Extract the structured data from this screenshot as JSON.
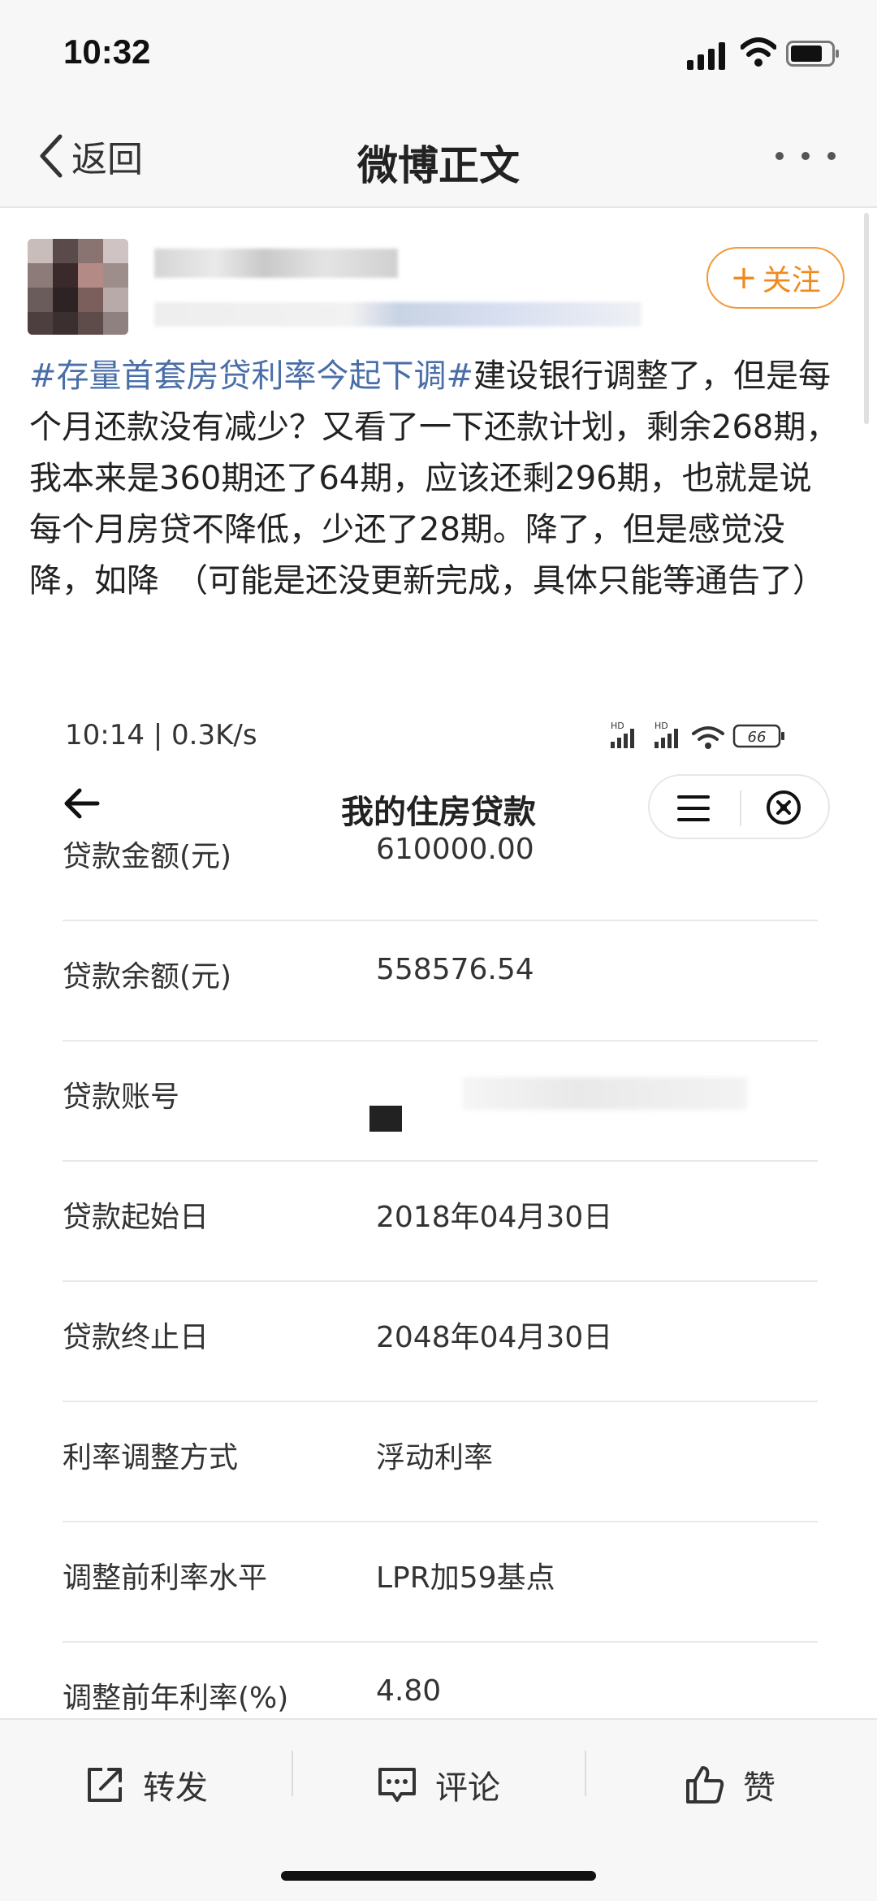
{
  "status_bar": {
    "time": "10:32",
    "signal_icon": "signal-icon",
    "wifi_icon": "wifi-icon",
    "battery_icon": "battery-icon"
  },
  "nav": {
    "back_label": "返回",
    "title": "微博正文",
    "more_icon": "more-icon"
  },
  "author": {
    "follow_label": "关注"
  },
  "post": {
    "hashtag": "#存量首套房贷利率今起下调#",
    "body": "建设银行调整了，但是每个月还款没有减少？又看了一下还款计划，剩余268期，我本来是360期还了64期，应该还剩296期，也就是说每个月房贷不降低，少还了28期。降了，但是感觉没降，如降　（可能是还没更新完成，具体只能等通告了）"
  },
  "embedded": {
    "status_text": "10:14 | 0.3K/s",
    "battery_level": "66",
    "title": "我的住房贷款",
    "rows": [
      {
        "label": "贷款金额(元)",
        "value": "610000.00"
      },
      {
        "label": "贷款余额(元)",
        "value": "558576.54"
      },
      {
        "label": "贷款账号",
        "value": ""
      },
      {
        "label": "贷款起始日",
        "value": "2018年04月30日"
      },
      {
        "label": "贷款终止日",
        "value": "2048年04月30日"
      },
      {
        "label": "利率调整方式",
        "value": "浮动利率"
      },
      {
        "label": "调整前利率水平",
        "value": "LPR加59基点"
      },
      {
        "label": "调整前年利率(%)",
        "value": "4.80"
      }
    ]
  },
  "bottom_bar": {
    "repost_label": "转发",
    "comment_label": "评论",
    "like_label": "赞"
  },
  "colors": {
    "hashtag": "#4a6ea8",
    "follow": "#f08a1e",
    "background": "#f7f7f7"
  }
}
